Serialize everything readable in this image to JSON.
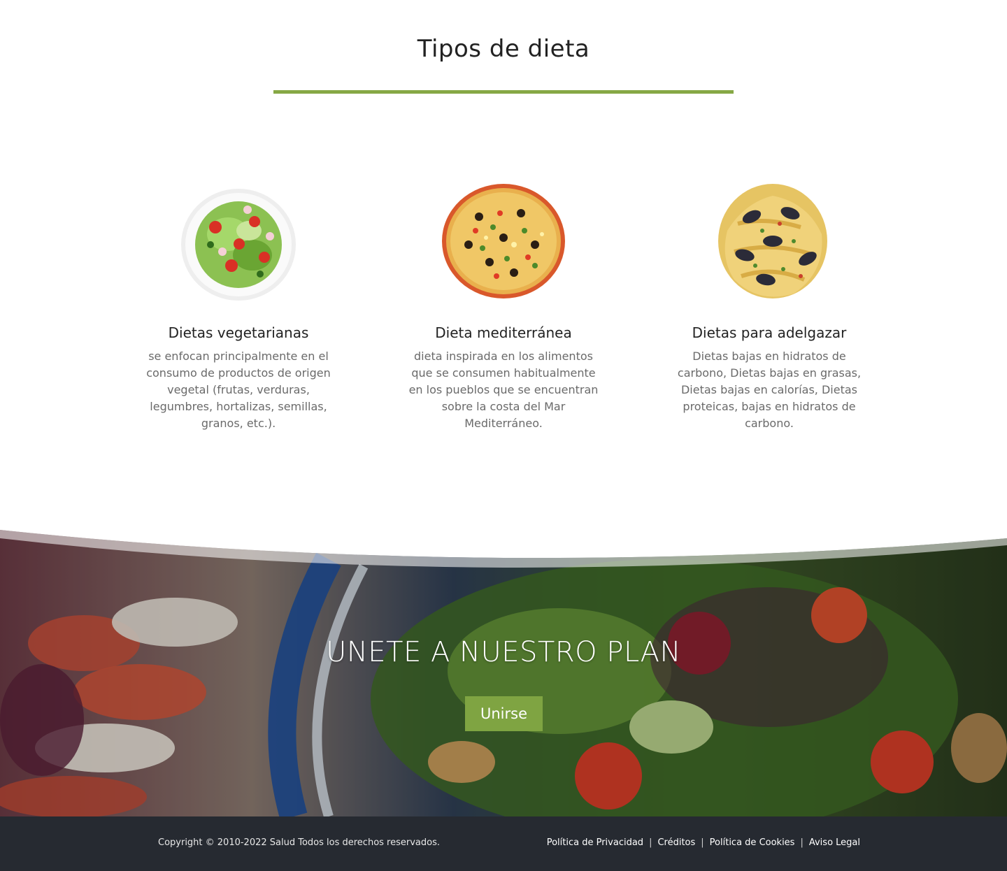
{
  "diet_section": {
    "title": "Tipos de dieta",
    "cards": [
      {
        "image_icon": "salad-bowl-image",
        "title": "Dietas vegetarianas",
        "text": "se enfocan principalmente en el consumo de productos de origen vegetal (frutas, verduras, legumbres, hortalizas, semillas, granos, etc.)."
      },
      {
        "image_icon": "pizza-image",
        "title": "Dieta mediterránea",
        "text": "dieta inspirada en los alimentos que se consumen habitualmente en los pueblos que se encuentran sobre la costa del Mar Mediterráneo."
      },
      {
        "image_icon": "seafood-pasta-image",
        "title": "Dietas para adelgazar",
        "text": "Dietas bajas en hidratos de carbono, Dietas bajas en grasas, Dietas bajas en calorías, Dietas proteicas, bajas en hidratos de carbono."
      }
    ]
  },
  "join_section": {
    "heading": "UNETE A NUESTRO PLAN",
    "button_label": "Unirse",
    "background_icon": "salad-photo-background"
  },
  "footer": {
    "copyright": "Copyright © 2010-2022 Salud Todos los derechos reservados.",
    "links": [
      "Política de Privacidad",
      "Créditos",
      "Política de Cookies",
      "Aviso Legal"
    ],
    "separator": "|"
  },
  "colors": {
    "accent": "#86a845",
    "button": "#7fa442",
    "footer_bg": "#262a31"
  }
}
